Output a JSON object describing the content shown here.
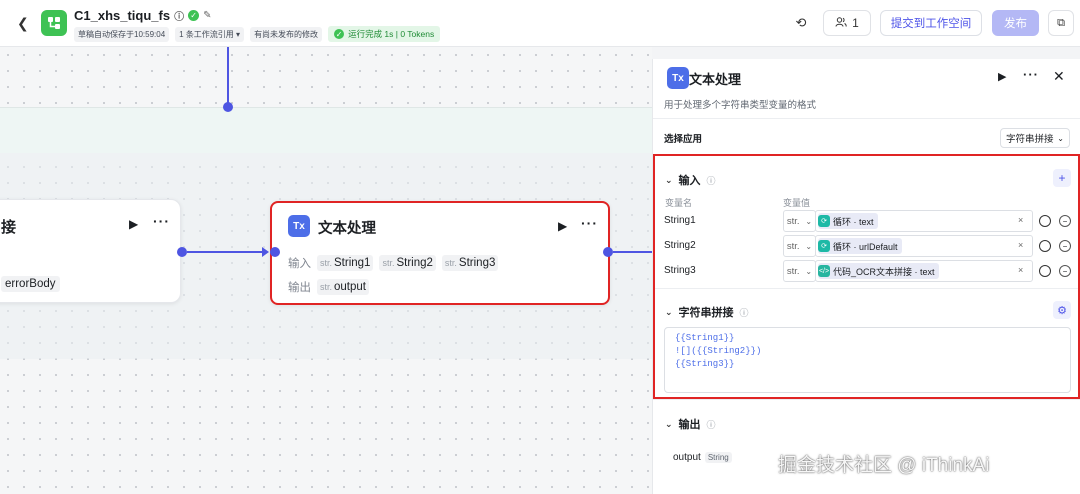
{
  "header": {
    "back_icon": "chevron-left-icon",
    "title": "C1_xhs_tiqu_fs",
    "autosave": "草稿自动保存于10:59:04",
    "references": "1 条工作流引用",
    "unpublished": "有尚未发布的修改",
    "run_status": "运行完成 1s | 0 Tokens",
    "collaborators": "1",
    "submit_label": "提交到工作空间",
    "publish_label": "发布",
    "accent_color": "#4d53e8",
    "success_color": "#3ec254"
  },
  "canvas": {
    "left_node": {
      "title": "接",
      "tag": "errorBody"
    },
    "main_node": {
      "icon_text": "Tx",
      "title": "文本处理",
      "input_label": "输入",
      "output_label": "输出",
      "type_prefix": "str.",
      "inputs": [
        "String1",
        "String2",
        "String3"
      ],
      "output": "output"
    }
  },
  "panel": {
    "icon_text": "Tx",
    "title": "文本处理",
    "description": "用于处理多个字符串类型变量的格式",
    "select_app_label": "选择应用",
    "select_app_value": "字符串拼接",
    "input_section": {
      "title": "输入",
      "col_name": "变量名",
      "col_value": "变量值",
      "rows": [
        {
          "name": "String1",
          "type": "str.",
          "ref_icon": "loop-icon",
          "ref": "循环 · text"
        },
        {
          "name": "String2",
          "type": "str.",
          "ref_icon": "loop-icon",
          "ref": "循环 · urlDefault"
        },
        {
          "name": "String3",
          "type": "str.",
          "ref_icon": "code-icon",
          "ref": "代码_OCR文本拼接 · text"
        }
      ]
    },
    "concat_section": {
      "title": "字符串拼接",
      "template": "{{String1}}\n![]({{String2}})\n{{String3}}"
    },
    "output_section": {
      "title": "输出",
      "name": "output",
      "type": "String"
    }
  },
  "watermark": "掘金技术社区 @ iThinkAi"
}
